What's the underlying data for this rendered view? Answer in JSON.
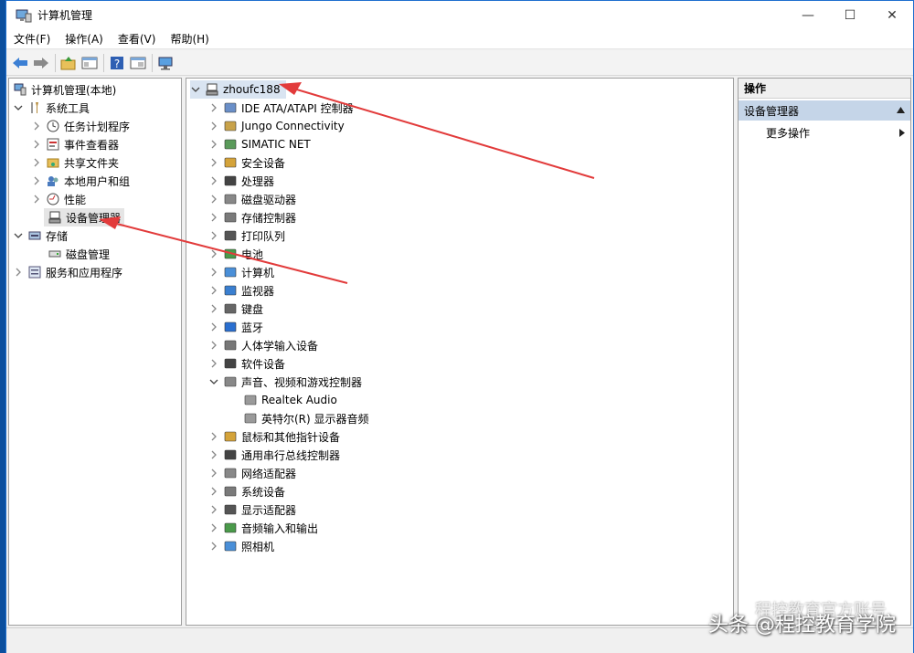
{
  "window": {
    "title": "计算机管理",
    "minimize": "—",
    "maximize": "☐",
    "close": "✕"
  },
  "menu": [
    "文件(F)",
    "操作(A)",
    "查看(V)",
    "帮助(H)"
  ],
  "left_tree": {
    "root": "计算机管理(本地)",
    "system_tools": "系统工具",
    "items": [
      "任务计划程序",
      "事件查看器",
      "共享文件夹",
      "本地用户和组",
      "性能",
      "设备管理器"
    ],
    "storage": "存储",
    "disk_management": "磁盘管理",
    "services": "服务和应用程序"
  },
  "device_tree": {
    "computer": "zhoufc188",
    "categories": [
      "IDE ATA/ATAPI 控制器",
      "Jungo Connectivity",
      "SIMATIC NET",
      "安全设备",
      "处理器",
      "磁盘驱动器",
      "存储控制器",
      "打印队列",
      "电池",
      "计算机",
      "监视器",
      "键盘",
      "蓝牙",
      "人体学输入设备",
      "软件设备",
      "声音、视频和游戏控制器"
    ],
    "sound_children": [
      "Realtek Audio",
      "英特尔(R) 显示器音频"
    ],
    "categories_after": [
      "鼠标和其他指针设备",
      "通用串行总线控制器",
      "网络适配器",
      "系统设备",
      "显示适配器",
      "音频输入和输出",
      "照相机"
    ]
  },
  "actions": {
    "header": "操作",
    "group": "设备管理器",
    "more": "更多操作"
  },
  "watermark": {
    "line1": "程控教育官方账号",
    "line2": "头条 @程控教育学院"
  },
  "colors": {
    "accent": "#1f6fcf",
    "arrow": "#e23b3b",
    "selection": "#e5e5e5",
    "action_group": "#c5d5e8"
  }
}
